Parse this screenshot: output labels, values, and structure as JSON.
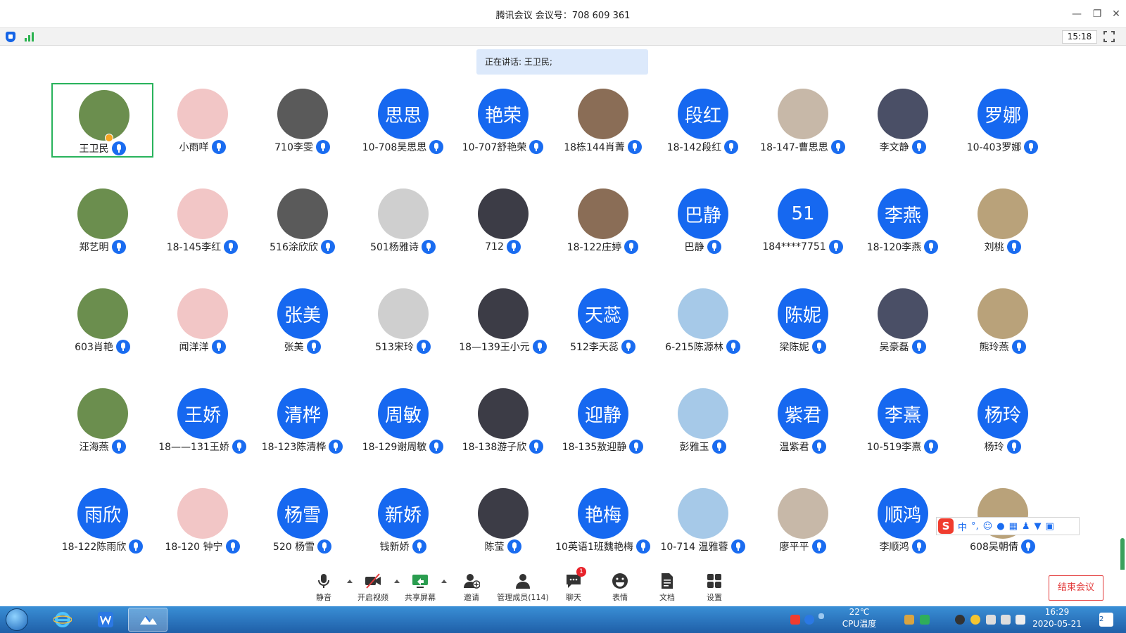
{
  "window": {
    "title": "腾讯会议 会议号：708 609 361",
    "minimize": "—",
    "restore": "❐",
    "close": "✕"
  },
  "topbar": {
    "elapsed_time": "15:18"
  },
  "speaking": {
    "text": "正在讲话: 王卫民;"
  },
  "colors": {
    "accent": "#1668f0",
    "active_border": "#29b35c",
    "end_button": "#e33b3b",
    "taskbar": "#2c77c4"
  },
  "participants": [
    {
      "name": "王卫民",
      "avatar_text": "",
      "avatar": "photo-tree",
      "host": true,
      "active": true
    },
    {
      "name": "小雨咩",
      "avatar_text": "",
      "avatar": "photo-girl-pink"
    },
    {
      "name": "710李雯",
      "avatar_text": "",
      "avatar": "photo-dark"
    },
    {
      "name": "10-708吴思思",
      "avatar_text": "思思",
      "avatar": "text"
    },
    {
      "name": "10-707舒艳荣",
      "avatar_text": "艳荣",
      "avatar": "text"
    },
    {
      "name": "18栋144肖菁",
      "avatar_text": "",
      "avatar": "photo-anime-girl"
    },
    {
      "name": "18-142段红",
      "avatar_text": "段红",
      "avatar": "text"
    },
    {
      "name": "18-147-曹思思",
      "avatar_text": "",
      "avatar": "photo-girl-outdoor"
    },
    {
      "name": "李文静",
      "avatar_text": "",
      "avatar": "photo-child"
    },
    {
      "name": "10-403罗娜",
      "avatar_text": "罗娜",
      "avatar": "text"
    },
    {
      "name": "郑艺明",
      "avatar_text": "",
      "avatar": "photo-man-suit"
    },
    {
      "name": "18-145李红",
      "avatar_text": "",
      "avatar": "photo-woman"
    },
    {
      "name": "516涂欣欣",
      "avatar_text": "",
      "avatar": "photo-woman-2"
    },
    {
      "name": "501杨雅诗",
      "avatar_text": "",
      "avatar": "photo-cartoon"
    },
    {
      "name": "712",
      "avatar_text": "",
      "avatar": "photo-drawing"
    },
    {
      "name": "18-122庄婷",
      "avatar_text": "",
      "avatar": "photo-cartoon-2"
    },
    {
      "name": "巴静",
      "avatar_text": "巴静",
      "avatar": "text"
    },
    {
      "name": "184****7751",
      "avatar_text": "51",
      "avatar": "text"
    },
    {
      "name": "18-120李燕",
      "avatar_text": "李燕",
      "avatar": "text"
    },
    {
      "name": "刘桃",
      "avatar_text": "",
      "avatar": "photo-woman-dark"
    },
    {
      "name": "603肖艳",
      "avatar_text": "",
      "avatar": "photo-bear"
    },
    {
      "name": "闻洋洋",
      "avatar_text": "",
      "avatar": "photo-anime"
    },
    {
      "name": "张美",
      "avatar_text": "张美",
      "avatar": "text"
    },
    {
      "name": "513宋玲",
      "avatar_text": "",
      "avatar": "photo-sunset"
    },
    {
      "name": "18—139王小元",
      "avatar_text": "",
      "avatar": "photo-sketch"
    },
    {
      "name": "512李天蕊",
      "avatar_text": "天蕊",
      "avatar": "text"
    },
    {
      "name": "6-215陈源林",
      "avatar_text": "",
      "avatar": "photo-blue-cat"
    },
    {
      "name": "梁陈妮",
      "avatar_text": "陈妮",
      "avatar": "text"
    },
    {
      "name": "吴豪磊",
      "avatar_text": "",
      "avatar": "photo-husky"
    },
    {
      "name": "熊玲燕",
      "avatar_text": "",
      "avatar": "photo-cartoon-3"
    },
    {
      "name": "汪海燕",
      "avatar_text": "",
      "avatar": "photo-dark-2"
    },
    {
      "name": "18——131王娇",
      "avatar_text": "王娇",
      "avatar": "text"
    },
    {
      "name": "18-123陈清桦",
      "avatar_text": "清桦",
      "avatar": "text"
    },
    {
      "name": "18-129谢周敏",
      "avatar_text": "周敏",
      "avatar": "text"
    },
    {
      "name": "18-138游子欣",
      "avatar_text": "",
      "avatar": "photo-girl"
    },
    {
      "name": "18-135敖迎静",
      "avatar_text": "迎静",
      "avatar": "text"
    },
    {
      "name": "彭雅玉",
      "avatar_text": "",
      "avatar": "photo-woman-mask"
    },
    {
      "name": "温紫君",
      "avatar_text": "紫君",
      "avatar": "text"
    },
    {
      "name": "10-519李熹",
      "avatar_text": "李熹",
      "avatar": "text"
    },
    {
      "name": "杨玲",
      "avatar_text": "杨玲",
      "avatar": "text"
    },
    {
      "name": "18-122陈雨欣",
      "avatar_text": "雨欣",
      "avatar": "text"
    },
    {
      "name": "18-120 钟宁",
      "avatar_text": "",
      "avatar": "photo-cat"
    },
    {
      "name": "520 杨雪",
      "avatar_text": "杨雪",
      "avatar": "text"
    },
    {
      "name": "钱新娇",
      "avatar_text": "新娇",
      "avatar": "text"
    },
    {
      "name": "陈莹",
      "avatar_text": "",
      "avatar": "photo-forest"
    },
    {
      "name": "10英语1班魏艳梅",
      "avatar_text": "艳梅",
      "avatar": "text"
    },
    {
      "name": "10-714 温雅蓉",
      "avatar_text": "",
      "avatar": "photo-placeholder"
    },
    {
      "name": "廖平平",
      "avatar_text": "",
      "avatar": "photo-woman-3"
    },
    {
      "name": "李顺鸿",
      "avatar_text": "顺鸿",
      "avatar": "text"
    },
    {
      "name": "608吴朝倩",
      "avatar_text": "",
      "avatar": "photo-woman-4"
    }
  ],
  "ime": {
    "logo": "S",
    "mode": "中",
    "punct": "°,"
  },
  "controls": {
    "mute": "静音",
    "video": "开启视频",
    "share": "共享屏幕",
    "invite": "邀请",
    "members": "管理成员(114)",
    "chat": "聊天",
    "chat_badge": "1",
    "emoji": "表情",
    "docs": "文档",
    "settings": "设置",
    "end": "结束会议"
  },
  "taskbar": {
    "temp": "22℃",
    "temp_label": "CPU温度",
    "time": "16:29",
    "date": "2020-05-21",
    "notify_count": "2"
  }
}
